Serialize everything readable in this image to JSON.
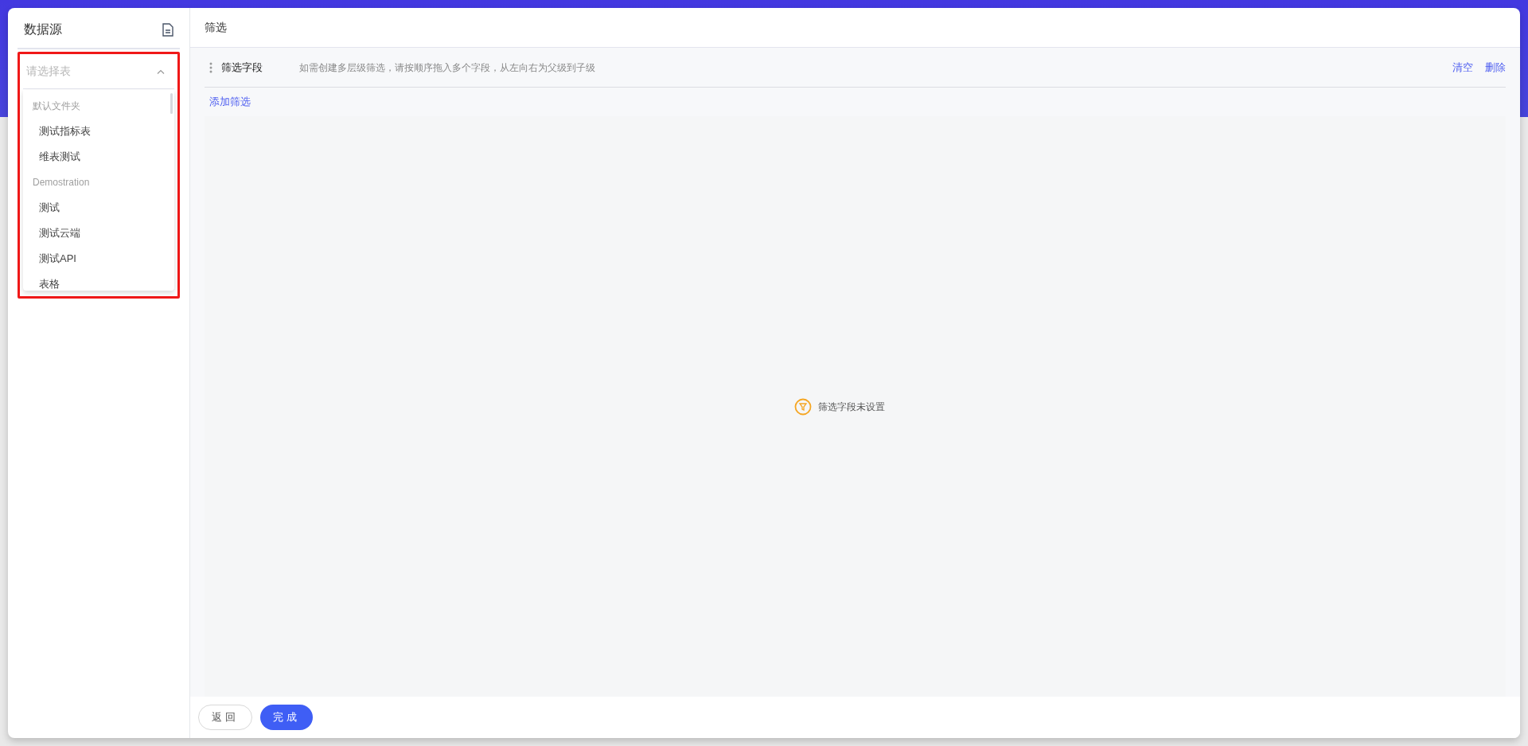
{
  "sidebar": {
    "title": "数据源",
    "select": {
      "placeholder": "请选择表",
      "expanded": true
    },
    "groups": [
      {
        "label": "默认文件夹",
        "items": [
          "测试指标表",
          "维表测试"
        ]
      },
      {
        "label": "Demostration",
        "items": [
          "测试",
          "测试云端",
          "测试API",
          "表格"
        ]
      }
    ]
  },
  "header": {
    "title": "筛选"
  },
  "filter_row": {
    "label": "筛选字段",
    "hint": "如需创建多层级筛选，请按顺序拖入多个字段，从左向右为父级到子级",
    "actions": [
      "清空",
      "删除"
    ]
  },
  "add_filter": "添加筛选",
  "empty_state": "筛选字段未设置",
  "footer": {
    "buttons": [
      {
        "label": "返回",
        "kind": "secondary"
      },
      {
        "label": "完成",
        "kind": "primary"
      }
    ]
  }
}
